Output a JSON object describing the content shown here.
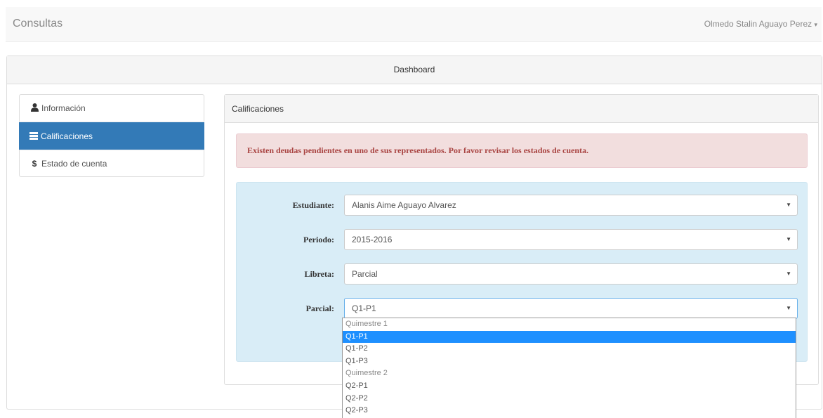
{
  "navbar": {
    "brand": "Consultas",
    "user": "Olmedo Stalin Aguayo Perez",
    "user_caret": "▾"
  },
  "dashboard": {
    "title": "Dashboard"
  },
  "sidebar": {
    "items": [
      {
        "icon": "user-icon",
        "label": "Información",
        "active": false
      },
      {
        "icon": "list-icon",
        "label": "Calificaciones",
        "active": true
      },
      {
        "icon": "dollar-icon",
        "label": "Estado de cuenta",
        "active": false
      }
    ],
    "dollar_glyph": "$",
    "user_glyph": "👤"
  },
  "calificaciones": {
    "title": "Calificaciones",
    "alert": "Existen deudas pendientes en uno de sus representados. Por favor revisar los estados de cuenta.",
    "fields": {
      "estudiante": {
        "label": "Estudiante:",
        "value": "Alanis Aime Aguayo Alvarez"
      },
      "periodo": {
        "label": "Periodo:",
        "value": "2015-2016"
      },
      "libreta": {
        "label": "Libreta:",
        "value": "Parcial"
      },
      "parcial": {
        "label": "Parcial:",
        "value": "Q1-P1"
      }
    },
    "caret": "▼"
  },
  "parcial_dropdown": {
    "options": [
      {
        "label": "Quimestre 1",
        "type": "group"
      },
      {
        "label": "Q1-P1",
        "type": "option",
        "selected": true
      },
      {
        "label": "Q1-P2",
        "type": "option"
      },
      {
        "label": "Q1-P3",
        "type": "option"
      },
      {
        "label": "Quimestre 2",
        "type": "group"
      },
      {
        "label": "Q2-P1",
        "type": "option"
      },
      {
        "label": "Q2-P2",
        "type": "option"
      },
      {
        "label": "Q2-P3",
        "type": "option"
      }
    ]
  },
  "colors": {
    "primary": "#337ab7",
    "alert_bg": "#f2dede",
    "alert_text": "#a94442",
    "form_bg": "#d9edf7",
    "selected_option": "#1e90ff"
  }
}
